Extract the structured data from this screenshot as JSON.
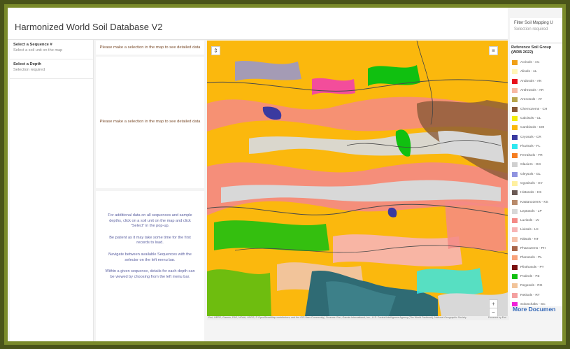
{
  "app": {
    "title": "Harmonized World Soil Database V2"
  },
  "filter": {
    "label": "Filter Soil Mapping U",
    "sublabel": "Selection required"
  },
  "left_panel": {
    "items": [
      {
        "label": "Select a Sequence #",
        "sub": "Select a soil unit on the map"
      },
      {
        "label": "Select a Depth",
        "sub": "Selection required"
      }
    ]
  },
  "detail": {
    "top_message": "Please make a selection in the map to see detailed data",
    "middle_message": "Please make a selection in the map to see detailed data",
    "info_paragraphs": [
      "For additional data on all sequences and sample depths, click on a soil unit on the map and click \"Select\" in the pop-up.",
      "Be patient as it may take some time for the first records to load.",
      "Navigate between available Sequences with the selector on the left menu bar.",
      "Within a given sequence, details for each depth can be viewed by choosing from the left menu bar."
    ]
  },
  "map": {
    "attribution": "Esri, HERE, Garmin, FAO, NOAA, USGS, © OpenStreetMap contributors, and the GIS User Community | Sources: Esri, Garmin International, Inc., U.S. Central Intelligence Agency (The World Factbook), National Geographic Society",
    "powered_by": "Powered by Esri",
    "zoom_in": "+",
    "zoom_out": "−",
    "expand_glyph": "⇕",
    "layers_glyph": "≡"
  },
  "legend": {
    "title": "Reference Soil Group (WRB 2022)",
    "items": [
      {
        "label": "Acrisols - AC",
        "color": "#f0a018"
      },
      {
        "label": "Alisols - AL",
        "color": "#fff6b8"
      },
      {
        "label": "Andosols - AN",
        "color": "#e8101a"
      },
      {
        "label": "Anthrosols - AR",
        "color": "#f7b9a4"
      },
      {
        "label": "Arenosols - AT",
        "color": "#b8a64c"
      },
      {
        "label": "Chernozems - CH",
        "color": "#8a5a38"
      },
      {
        "label": "Calcisols - CL",
        "color": "#f2ec0a"
      },
      {
        "label": "Cambisols - CM",
        "color": "#fbb80d"
      },
      {
        "label": "Cryosols - CR",
        "color": "#3a3aa0"
      },
      {
        "label": "Fluvisols - FL",
        "color": "#2ee8f0"
      },
      {
        "label": "Ferralsols - FR",
        "color": "#f57e22"
      },
      {
        "label": "Glaciers - GG",
        "color": "#d0d0d0"
      },
      {
        "label": "Gleysols - GL",
        "color": "#8f93e0"
      },
      {
        "label": "Gypsisols - GY",
        "color": "#fff0a0"
      },
      {
        "label": "Histosols - HS",
        "color": "#6b5a55"
      },
      {
        "label": "Kastanozems - KS",
        "color": "#b88a6a"
      },
      {
        "label": "Leptosols - LP",
        "color": "#d8d8d8"
      },
      {
        "label": "Luvisols - LV",
        "color": "#f48a86"
      },
      {
        "label": "Lixisols - LX",
        "color": "#f7b5b5"
      },
      {
        "label": "Nitisols - NT",
        "color": "#f6c2aa"
      },
      {
        "label": "Phaeozems - PH",
        "color": "#a8664a"
      },
      {
        "label": "Planosols - PL",
        "color": "#f8a27a"
      },
      {
        "label": "Plinthosols - PT",
        "color": "#7a1010"
      },
      {
        "label": "Podzols - PZ",
        "color": "#10c010"
      },
      {
        "label": "Regosols - RG",
        "color": "#f2c49a"
      },
      {
        "label": "Retisols - RT",
        "color": "#f4a0a0"
      },
      {
        "label": "Solonchaks - SC",
        "color": "#f020d8"
      }
    ]
  },
  "more_link": {
    "label": "More Documen"
  }
}
